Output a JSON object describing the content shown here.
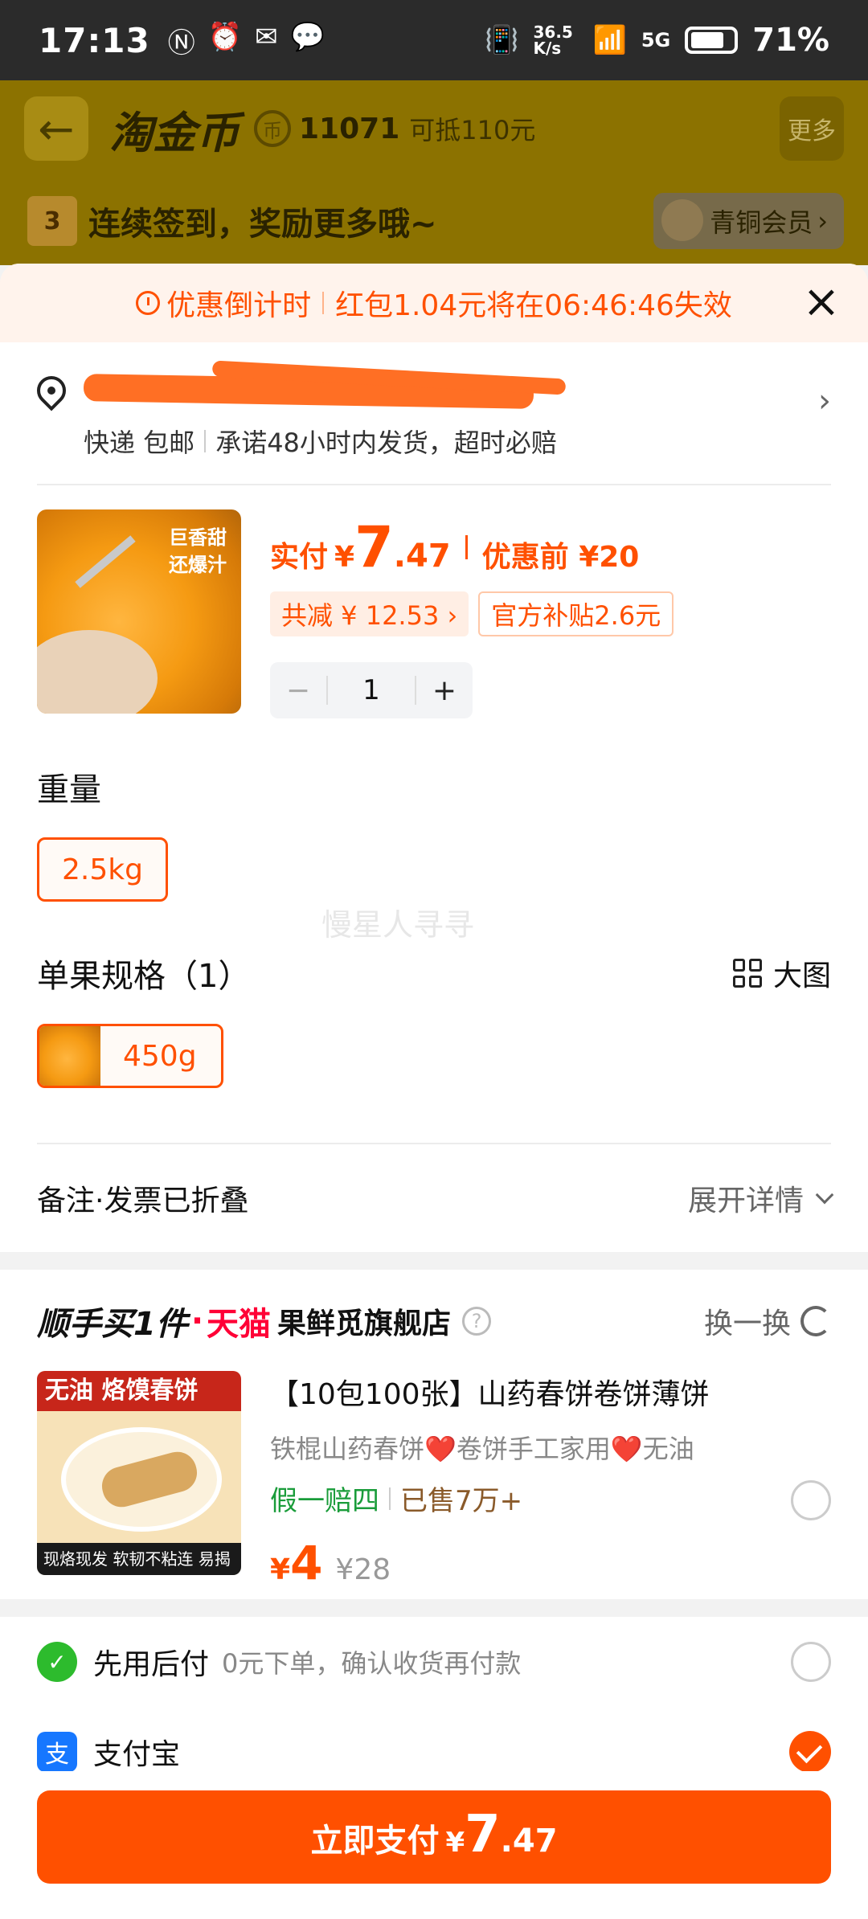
{
  "status_bar": {
    "time": "17:13",
    "net_speed": "36.5 K/s",
    "network": "5G",
    "battery": "71%"
  },
  "background_header": {
    "title": "淘金币",
    "coins": "11071",
    "coins_value": "可抵110元",
    "more_label": "更多",
    "calendar_day": "3",
    "promo": "连续签到，奖励更多哦~",
    "member_label": "青铜会员",
    "member_chevron": "›"
  },
  "countdown": {
    "label": "优惠倒计时",
    "message": "红包1.04元将在06:46:46失效"
  },
  "address": {
    "shipping": "快递 包邮",
    "promise": "承诺48小时内发货，超时必赔"
  },
  "product": {
    "thumb_text": "巨香甜\n还爆汁",
    "pay_label": "实付",
    "currency": "¥",
    "price_int": "7",
    "price_dec": ".47",
    "original_label": "优惠前 ¥20",
    "discount_tag": "共减 ¥ 12.53 ›",
    "subsidy_tag": "官方补贴2.6元",
    "quantity": "1",
    "minus": "−",
    "plus": "+"
  },
  "weight": {
    "title": "重量",
    "option": "2.5kg"
  },
  "watermark": "慢星人寻寻",
  "spec": {
    "title": "单果规格（1）",
    "big_image_label": "大图",
    "option": "450g"
  },
  "notes": {
    "label": "备注·发票已折叠",
    "expand_label": "展开详情"
  },
  "addon": {
    "title": "顺手买1件",
    "dot": "·",
    "tmall": "天猫",
    "shop": "果鲜觅旗舰店",
    "help": "?",
    "swap_label": "换一换",
    "thumb_top": "无油 烙馍春饼",
    "thumb_bottom": "现烙现发 软韧不粘连 易揭开",
    "name": "【10包100张】山药春饼卷饼薄饼",
    "desc": "铁棍山药春饼❤️卷饼手工家用❤️无油",
    "badge_fake": "假一赔四",
    "badge_sold": "已售7万+",
    "currency": "¥",
    "price": "4",
    "old_price": "¥28"
  },
  "payment": {
    "later_name": "先用后付",
    "later_desc": "0元下单，确认收货再付款",
    "alipay_name": "支付宝",
    "alipay_icon": "支"
  },
  "pay_button": {
    "label": "立即支付",
    "currency": "¥",
    "amount_int": "7",
    "amount_dec": ".47"
  },
  "colors": {
    "accent": "#ff5000",
    "tmall": "#ff0036",
    "green": "#1a9c3a"
  }
}
